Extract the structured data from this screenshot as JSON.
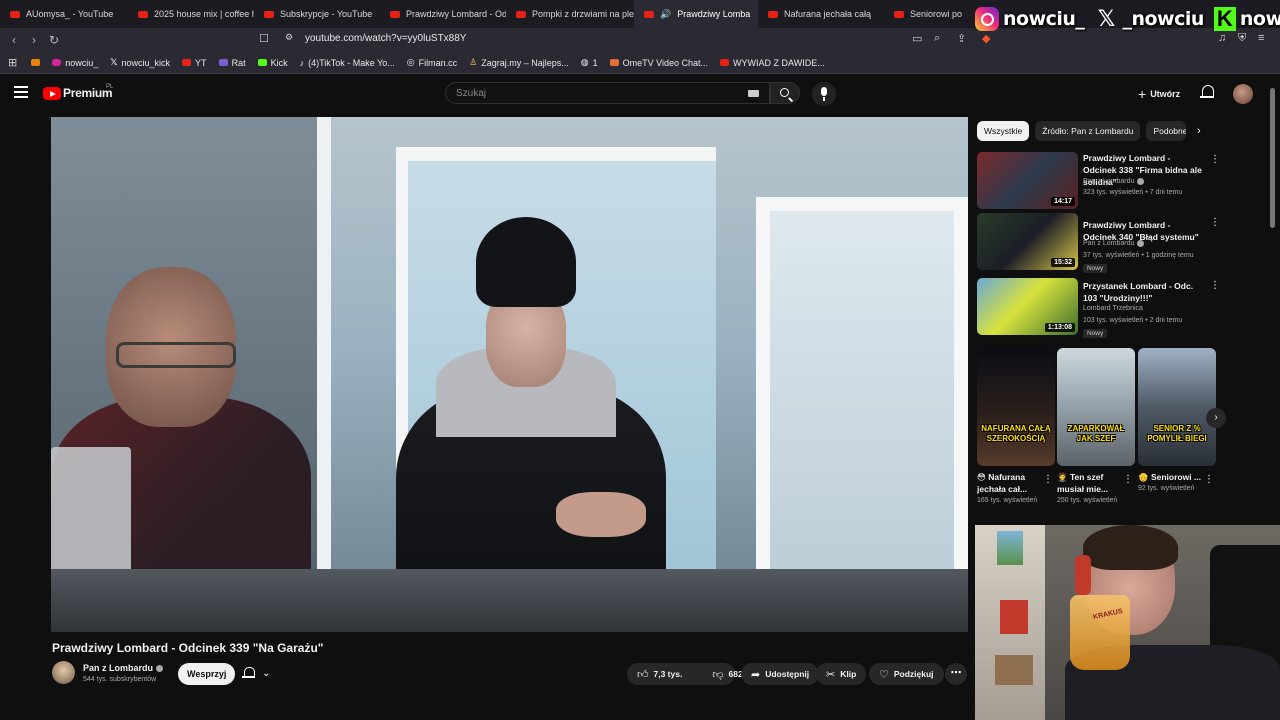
{
  "browser": {
    "tabs": [
      {
        "label": "AUomysa_ - YouTube",
        "icon": "youtube-favicon"
      },
      {
        "label": "2025 house mix | coffee h",
        "icon": "youtube-favicon"
      },
      {
        "label": "Subskrypcje - YouTube",
        "icon": "youtube-favicon"
      },
      {
        "label": "Prawdziwy Lombard - Odc",
        "icon": "youtube-favicon"
      },
      {
        "label": "Pompki z drzwiami na ple",
        "icon": "youtube-favicon"
      },
      {
        "label": "Prawdziwy Lomba",
        "icon": "youtube-favicon",
        "active": true
      },
      {
        "label": "Nafurana jechała całą",
        "icon": "youtube-favicon"
      },
      {
        "label": "Seniorowi po",
        "icon": "youtube-favicon"
      }
    ],
    "url": "youtube.com/watch?v=yy0luSTx88Y",
    "bookmarks": [
      "nowciu_",
      "nowciu_kick",
      "YT",
      "Rat",
      "Kick",
      "(4)TikTok - Make Yo...",
      "Filman.cc",
      "Zagraj.my – Najleps...",
      "1",
      "OmeTV Video Chat...",
      "WYWIAD Z DAWIDE..."
    ]
  },
  "overlay": {
    "instagram": "nowciu_",
    "x": "_nowciu",
    "kick": "nowciu"
  },
  "header": {
    "brand": "Premium",
    "region": "PL",
    "search_placeholder": "Szukaj",
    "create_label": "Utwórz"
  },
  "video": {
    "title": "Prawdziwy Lombard - Odcinek 339 \"Na Garażu\"",
    "channel": "Pan z Lombardu",
    "subscribers": "544 tys. subskrybentów",
    "support_label": "Wesprzyj",
    "likes": "7,3 tys.",
    "dislikes": "682",
    "share_label": "Udostępnij",
    "clip_label": "Klip",
    "thanks_label": "Podziękuj"
  },
  "sidebar": {
    "chips": [
      "Wszystkie",
      "Źródło: Pan z Lombardu",
      "Podobne"
    ],
    "recommendations": [
      {
        "title": "Prawdziwy Lombard - Odcinek 338 \"Firma bidna ale solidna\"",
        "channel": "Pan z Lombardu",
        "meta": "323 tys. wyświetleń • 7 dni temu",
        "duration": "14:17",
        "badge": ""
      },
      {
        "title": "Prawdziwy Lombard - Odcinek 340 \"Błąd systemu\"",
        "channel": "Pan z Lombardu",
        "meta": "37 tys. wyświetleń • 1 godzinę temu",
        "duration": "15:32",
        "badge": "Nowy"
      },
      {
        "title": "Przystanek Lombard - Odc. 103 \"Urodziny!!!\"",
        "channel": "Lombard Trzebnica",
        "meta": "103 tys. wyświetleń • 2 dni temu",
        "duration": "1:13:08",
        "badge": "Nowy"
      }
    ],
    "shorts": [
      {
        "caption": "NAFURANA CAŁĄ SZEROKOŚCIĄ",
        "title": "😳 Nafurana jechała cał...",
        "views": "165 tys. wyświetleń"
      },
      {
        "caption": "ZAPARKOWAŁ JAK SZEF",
        "title": "🤵 Ten szef musiał mie...",
        "views": "250 tys. wyświetleń"
      },
      {
        "caption": "SENIOR Z % POMYLIŁ BIEGI",
        "title": "👴 Seniorowi ...",
        "views": "92 tys. wyświetleń"
      }
    ]
  },
  "webcam": {
    "glass_label": "KRAKUS"
  }
}
